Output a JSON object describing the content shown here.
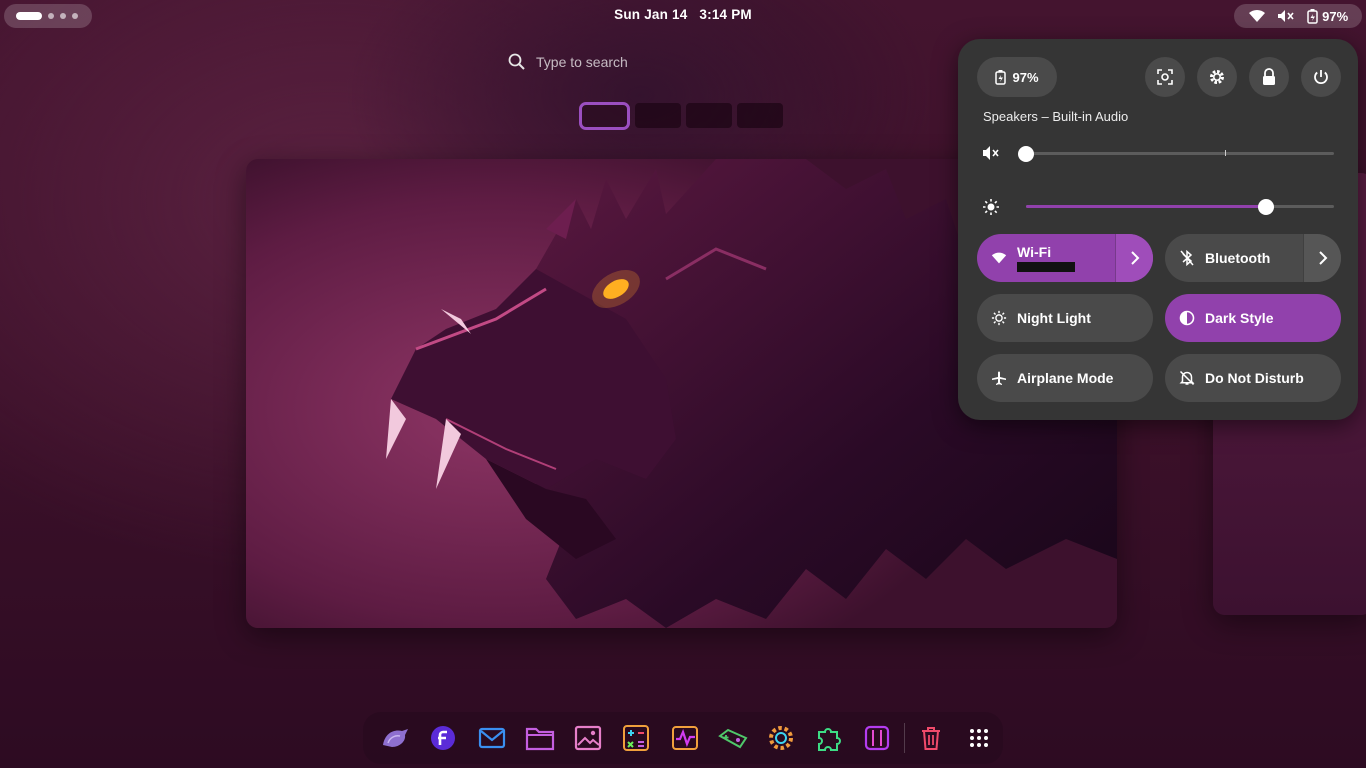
{
  "topbar": {
    "date": "Sun Jan 14",
    "time": "3:14 PM",
    "battery_percent": "97%",
    "icons": [
      "wifi-icon",
      "volume-muted-icon",
      "battery-icon"
    ]
  },
  "search": {
    "placeholder": "Type to search"
  },
  "workspaces": {
    "count": 4,
    "active_index": 0
  },
  "quick_settings": {
    "battery_label": "97%",
    "actions": [
      "screenshot-icon",
      "settings-icon",
      "lock-icon",
      "power-icon"
    ],
    "output_device": "Speakers – Built-in Audio",
    "volume": {
      "value": 0,
      "icon": "volume-muted-icon"
    },
    "brightness": {
      "value": 0.78,
      "icon": "brightness-icon"
    },
    "toggles": [
      {
        "label": "Wi-Fi",
        "on": true,
        "icon": "wifi-icon",
        "has_arrow": true
      },
      {
        "label": "Bluetooth",
        "on": false,
        "icon": "bluetooth-disabled-icon",
        "has_arrow": true
      },
      {
        "label": "Night Light",
        "on": false,
        "icon": "night-light-icon"
      },
      {
        "label": "Dark Style",
        "on": true,
        "icon": "dark-style-icon"
      },
      {
        "label": "Airplane Mode",
        "on": false,
        "icon": "airplane-icon"
      },
      {
        "label": "Do Not Disturb",
        "on": false,
        "icon": "do-not-disturb-icon"
      }
    ]
  },
  "dock": {
    "apps": [
      "web-browser-icon",
      "fedora-icon",
      "mail-icon",
      "files-icon",
      "image-viewer-icon",
      "calculator-icon",
      "system-monitor-icon",
      "game-controller-icon",
      "settings-icon",
      "extensions-icon",
      "boxes-icon",
      "trash-icon",
      "show-apps-icon"
    ]
  },
  "colors": {
    "accent": "#9141ac",
    "panel": "#353535",
    "tile": "#4a4a4a"
  }
}
